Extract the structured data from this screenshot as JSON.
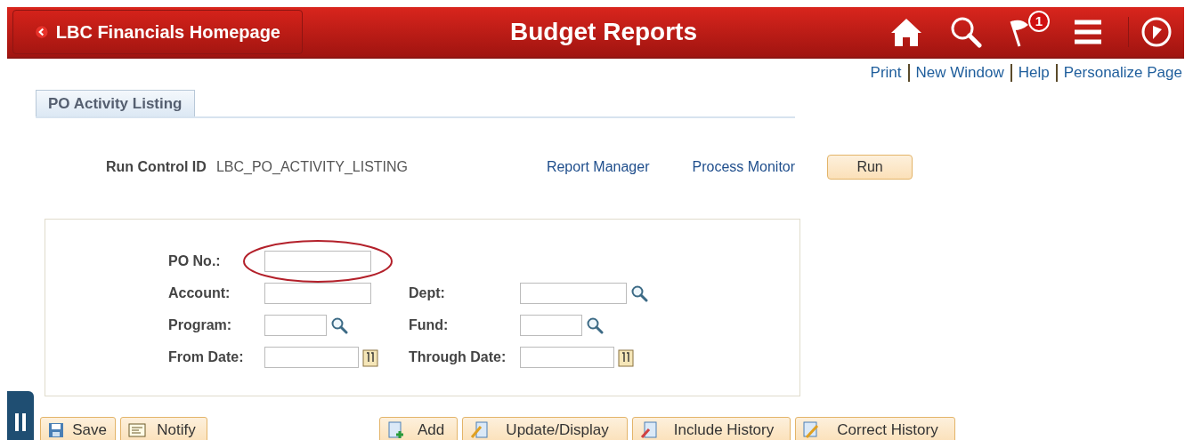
{
  "header": {
    "back_button": "LBC Financials Homepage",
    "title": "Budget Reports",
    "notification_count": "1"
  },
  "links": [
    "Print",
    "New Window",
    "Help",
    "Personalize Page"
  ],
  "tabs": [
    {
      "label": "PO Activity Listing",
      "selected": true
    }
  ],
  "run_control": {
    "label": "Run Control ID",
    "value": "LBC_PO_ACTIVITY_LISTING",
    "links": [
      "Report Manager",
      "Process Monitor"
    ],
    "run_button": "Run"
  },
  "form": {
    "rows": [
      {
        "left": {
          "label": "PO No.:",
          "kind": "text",
          "highlighted": true
        }
      },
      {
        "left": {
          "label": "Account:",
          "kind": "text"
        },
        "right": {
          "label": "Dept:",
          "kind": "lookup"
        }
      },
      {
        "left": {
          "label": "Program:",
          "kind": "lookup"
        },
        "right": {
          "label": "Fund:",
          "kind": "lookup"
        }
      },
      {
        "left": {
          "label": "From Date:",
          "kind": "date"
        },
        "right": {
          "label": "Through Date:",
          "kind": "date"
        }
      }
    ]
  },
  "toolbar": {
    "left": [
      {
        "label": "Save"
      },
      {
        "label": "Notify"
      }
    ],
    "right": [
      {
        "label": "Add"
      },
      {
        "label": "Update/Display"
      },
      {
        "label": "Include History"
      },
      {
        "label": "Correct History"
      }
    ]
  }
}
